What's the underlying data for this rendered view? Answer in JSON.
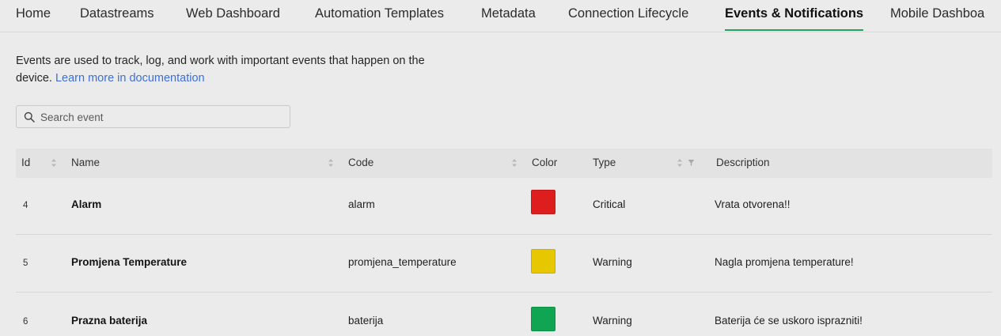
{
  "tabs": [
    {
      "label": "Home",
      "active": false
    },
    {
      "label": "Datastreams",
      "active": false
    },
    {
      "label": "Web Dashboard",
      "active": false
    },
    {
      "label": "Automation Templates",
      "active": false
    },
    {
      "label": "Metadata",
      "active": false
    },
    {
      "label": "Connection Lifecycle",
      "active": false
    },
    {
      "label": "Events & Notifications",
      "active": true
    },
    {
      "label": "Mobile Dashboa",
      "active": false
    }
  ],
  "intro": {
    "text": "Events are used to track, log, and work with important events that happen on the device. ",
    "link_label": "Learn more in documentation"
  },
  "search": {
    "placeholder": "Search event",
    "value": "",
    "icon": "search-icon"
  },
  "table": {
    "columns": {
      "id": "Id",
      "name": "Name",
      "code": "Code",
      "color": "Color",
      "type": "Type",
      "description": "Description"
    },
    "rows": [
      {
        "id": "4",
        "name": "Alarm",
        "code": "alarm",
        "color": "#dc1e1e",
        "type": "Critical",
        "description": "Vrata otvorena!!"
      },
      {
        "id": "5",
        "name": "Promjena Temperature",
        "code": "promjena_temperature",
        "color": "#e6c700",
        "type": "Warning",
        "description": "Nagla promjena temperature!"
      },
      {
        "id": "6",
        "name": "Prazna baterija",
        "code": "baterija",
        "color": "#0fa552",
        "type": "Warning",
        "description": "Baterija će se uskoro isprazniti!"
      }
    ]
  },
  "colors": {
    "accent": "#23a35f",
    "link": "#3d6fd6"
  }
}
